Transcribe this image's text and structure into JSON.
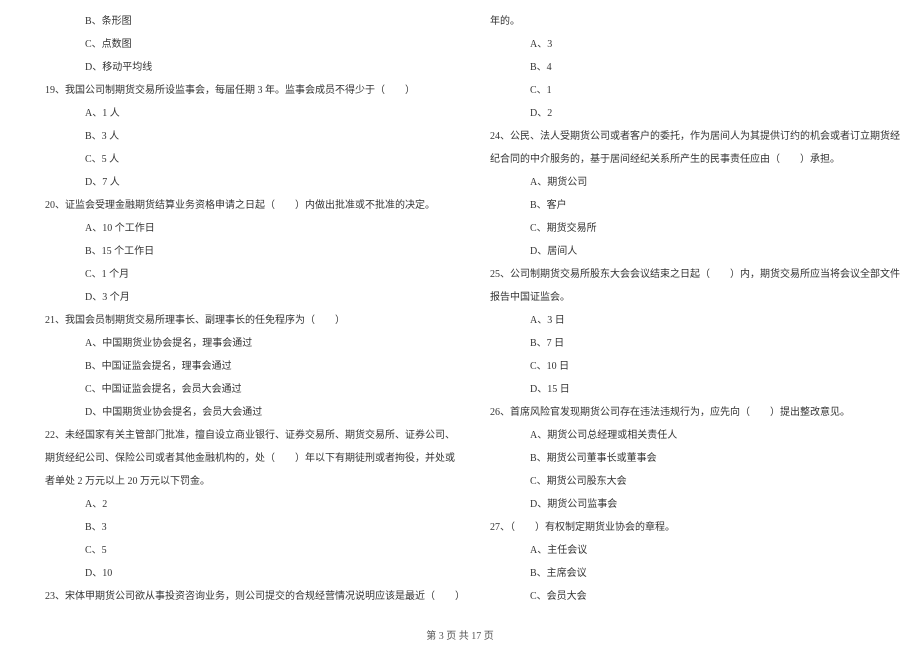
{
  "left": {
    "q18_opts": [
      "B、条形图",
      "C、点数图",
      "D、移动平均线"
    ],
    "q19": "19、我国公司制期货交易所设监事会，每届任期 3 年。监事会成员不得少于（　　）",
    "q19_opts": [
      "A、1 人",
      "B、3 人",
      "C、5 人",
      "D、7 人"
    ],
    "q20": "20、证监会受理金融期货结算业务资格申请之日起（　　）内做出批准或不批准的决定。",
    "q20_opts": [
      "A、10 个工作日",
      "B、15 个工作日",
      "C、1 个月",
      "D、3 个月"
    ],
    "q21": "21、我国会员制期货交易所理事长、副理事长的任免程序为（　　）",
    "q21_opts": [
      "A、中国期货业协会提名，理事会通过",
      "B、中国证监会提名，理事会通过",
      "C、中国证监会提名，会员大会通过",
      "D、中国期货业协会提名，会员大会通过"
    ],
    "q22_l1": "22、未经国家有关主管部门批准，擅自设立商业银行、证券交易所、期货交易所、证券公司、",
    "q22_l2": "期货经纪公司、保险公司或者其他金融机构的，处（　　）年以下有期徒刑或者拘役，并处或",
    "q22_l3": "者单处 2 万元以上 20 万元以下罚金。",
    "q22_opts": [
      "A、2",
      "B、3",
      "C、5",
      "D、10"
    ],
    "q23": "23、宋体甲期货公司欲从事投资咨询业务，则公司提交的合规经营情况说明应该是最近（　　）"
  },
  "right": {
    "q23_tail": "年的。",
    "q23_opts": [
      "A、3",
      "B、4",
      "C、1",
      "D、2"
    ],
    "q24_l1": "24、公民、法人受期货公司或者客户的委托，作为居间人为其提供订约的机会或者订立期货经",
    "q24_l2": "纪合同的中介服务的，基于居间经纪关系所产生的民事责任应由（　　）承担。",
    "q24_opts": [
      "A、期货公司",
      "B、客户",
      "C、期货交易所",
      "D、居间人"
    ],
    "q25_l1": "25、公司制期货交易所股东大会会议结束之日起（　　）内，期货交易所应当将会议全部文件",
    "q25_l2": "报告中国证监会。",
    "q25_opts": [
      "A、3 日",
      "B、7 日",
      "C、10 日",
      "D、15 日"
    ],
    "q26": "26、首席风险官发现期货公司存在违法违规行为，应先向（　　）提出整改意见。",
    "q26_opts": [
      "A、期货公司总经理或相关责任人",
      "B、期货公司董事长或董事会",
      "C、期货公司股东大会",
      "D、期货公司监事会"
    ],
    "q27": "27、（　　）有权制定期货业协会的章程。",
    "q27_opts": [
      "A、主任会议",
      "B、主席会议",
      "C、会员大会"
    ]
  },
  "footer": "第 3 页 共 17 页"
}
